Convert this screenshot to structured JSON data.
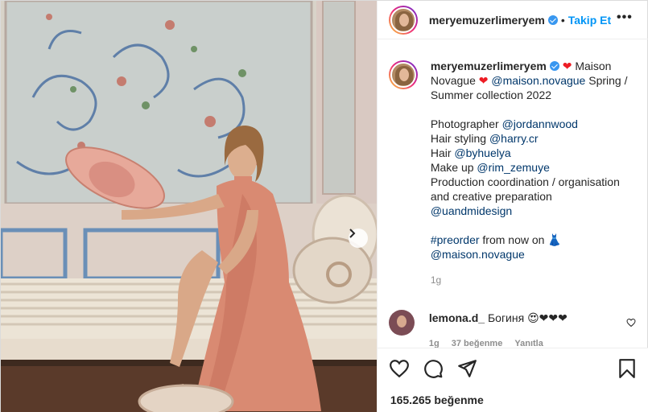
{
  "header": {
    "username": "meryemuzerlimeryem",
    "separator": "•",
    "follow_label": "Takip Et",
    "more_label": "•••"
  },
  "caption": {
    "username": "meryemuzerlimeryem",
    "heart1": "❤",
    "part1": " Maison Novague ",
    "heart2": "❤",
    "mention1": "@maison.novague",
    "part2": " Spring / Summer collection 2022",
    "photographer_label": "Photographer ",
    "photographer": "@jordannwood",
    "hairstyling_label": "Hair styling ",
    "hairstyling": "@harry.cr",
    "hair_label": "Hair ",
    "hair": "@byhuelya",
    "makeup_label": "Make up ",
    "makeup": "@rim_zemuye",
    "production": "Production coordination / organisation and creative preparation",
    "design": "@uandmidesign",
    "hashtag": "#preorder",
    "preorder_text": " from now on 👗",
    "mention_end": "@maison.novague",
    "time": "1g"
  },
  "comment": {
    "username": "lemona.d_",
    "text": " Богиня 😍❤❤❤",
    "time": "1g",
    "likes": "37 beğenme",
    "reply": "Yanıtla"
  },
  "actions": {
    "likes_count": "165.265 beğenme"
  },
  "icons": {
    "like": "heart-outline-icon",
    "comment": "comment-bubble-icon",
    "share": "paper-plane-icon",
    "save": "bookmark-icon",
    "next": "chevron-right-icon"
  },
  "colors": {
    "accent": "#0095f6",
    "link": "#00376b",
    "heart": "#ed1c24",
    "muted": "#8e8e8e"
  }
}
